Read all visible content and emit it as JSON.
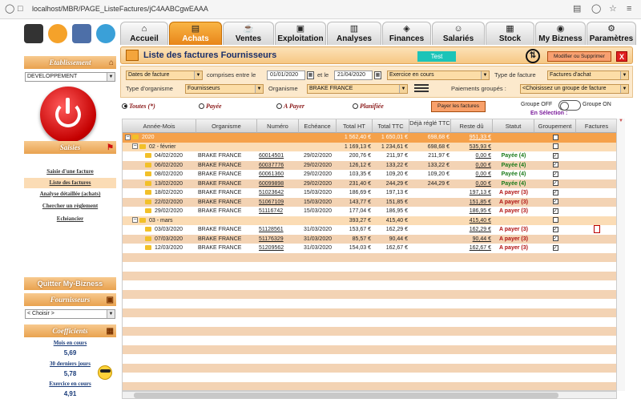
{
  "browser": {
    "url": "localhost/MBR/PAGE_ListeFactures/jC4AABCgwEAAA"
  },
  "colors": {
    "accent": "#F29A2E",
    "header_bar": "#F6C783",
    "paid": "#1A7A1A",
    "due": "#B01010",
    "test_badge": "#1BC4B8"
  },
  "sidebar": {
    "etablissement_title": "Etablissement",
    "etablissement_value": "DEVELOPPEMENT",
    "saisies_title": "Saisies",
    "menu": [
      "Saisie d'une facture",
      "Liste des factures",
      "Analyse détaillée (achats)",
      "Chercher un règlement",
      "Echéancier"
    ],
    "quit_label": "Quitter My-Bizness",
    "fournisseurs_title": "Fournisseurs",
    "fournisseurs_value": "< Choisir >",
    "coefficients_title": "Coefficients",
    "coefs": [
      {
        "label": "Mois en cours",
        "value": "5,69"
      },
      {
        "label": "30 derniers jours",
        "value": "5,78"
      },
      {
        "label": "Exercice en cours",
        "value": "4,91"
      }
    ]
  },
  "tabs": [
    {
      "label": "Accueil",
      "icon": "house-icon"
    },
    {
      "label": "Achats",
      "icon": "basket-icon"
    },
    {
      "label": "Ventes",
      "icon": "cup-icon"
    },
    {
      "label": "Exploitation",
      "icon": "machine-icon"
    },
    {
      "label": "Analyses",
      "icon": "chart-icon"
    },
    {
      "label": "Finances",
      "icon": "money-icon"
    },
    {
      "label": "Salariés",
      "icon": "people-icon"
    },
    {
      "label": "Stock",
      "icon": "box-icon"
    },
    {
      "label": "My Bizness",
      "icon": "brand-icon"
    },
    {
      "label": "Paramètres",
      "icon": "gears-icon"
    }
  ],
  "page": {
    "title": "Liste des factures Fournisseurs",
    "test_badge": "Test",
    "modify_button": "Modifier ou Supprimer",
    "close_button": "X"
  },
  "filters": {
    "date_type": "Dates de facture",
    "between_label": "comprises entre le",
    "date_from": "01/01/2020",
    "and_label": "et le",
    "date_to": "21/04/2020",
    "period": "Exercice en cours",
    "type_facture_label": "Type de facture",
    "type_facture": "Factures d'achat",
    "type_org_label": "Type d'organisme",
    "type_org": "Fournisseurs",
    "organisme_label": "Organisme",
    "organisme": "BRAKE FRANCE",
    "paiements_label": "Paiements groupés :",
    "paiements": "<Choisissez un groupe de facture"
  },
  "status_filter": {
    "options": [
      "Toutes (*)",
      "Payée",
      "A Payer",
      "Planifiée"
    ],
    "selected": 0,
    "pay_button": "Payer les factures",
    "group_off": "Groupe OFF",
    "group_on": "Groupe ON",
    "en_selection": "En Sélection :"
  },
  "table": {
    "columns": [
      "Année-Mois",
      "Organisme",
      "Numéro",
      "Echéance",
      "Total HT",
      "Total TTC",
      "Déjà réglé TTC",
      "Reste dû",
      "Statut",
      "Groupement",
      "Factures"
    ],
    "rows": [
      {
        "level": 0,
        "label": "2020",
        "ht": "1 562,40 €",
        "ttc": "1 650,01 €",
        "regle": "698,68 €",
        "reste": "951,33 €",
        "group": "unchecked",
        "style": "year"
      },
      {
        "level": 1,
        "label": "02 - février",
        "ht": "1 169,13 €",
        "ttc": "1 234,61 €",
        "regle": "698,68 €",
        "reste": "535,93 €",
        "group": "unchecked",
        "style": "month"
      },
      {
        "level": 2,
        "label": "04/02/2020",
        "org": "BRAKE FRANCE",
        "num": "60014501",
        "ech": "29/02/2020",
        "ht": "200,76 €",
        "ttc": "211,97 €",
        "regle": "211,97 €",
        "reste": "0,00 €",
        "statut": "Payée (4)",
        "group": "checked",
        "style": "light"
      },
      {
        "level": 2,
        "label": "06/02/2020",
        "org": "BRAKE FRANCE",
        "num": "60037776",
        "ech": "29/02/2020",
        "ht": "126,12 €",
        "ttc": "133,22 €",
        "regle": "133,22 €",
        "reste": "0,00 €",
        "statut": "Payée (4)",
        "group": "checked",
        "style": "dark"
      },
      {
        "level": 2,
        "label": "08/02/2020",
        "org": "BRAKE FRANCE",
        "num": "60061360",
        "ech": "29/02/2020",
        "ht": "103,35 €",
        "ttc": "109,20 €",
        "regle": "109,20 €",
        "reste": "0,00 €",
        "statut": "Payée (4)",
        "group": "checked",
        "style": "light"
      },
      {
        "level": 2,
        "label": "13/02/2020",
        "org": "BRAKE FRANCE",
        "num": "60099898",
        "ech": "29/02/2020",
        "ht": "231,40 €",
        "ttc": "244,29 €",
        "regle": "244,29 €",
        "reste": "0,00 €",
        "statut": "Payée (4)",
        "group": "checked",
        "style": "dark"
      },
      {
        "level": 2,
        "label": "18/02/2020",
        "org": "BRAKE FRANCE",
        "num": "51023642",
        "ech": "15/03/2020",
        "ht": "186,69 €",
        "ttc": "197,13 €",
        "regle": "",
        "reste": "197,13 €",
        "statut": "A payer (3)",
        "group": "checked",
        "style": "light"
      },
      {
        "level": 2,
        "label": "22/02/2020",
        "org": "BRAKE FRANCE",
        "num": "51067109",
        "ech": "15/03/2020",
        "ht": "143,77 €",
        "ttc": "151,85 €",
        "regle": "",
        "reste": "151,85 €",
        "statut": "A payer (3)",
        "group": "checked",
        "style": "dark"
      },
      {
        "level": 2,
        "label": "29/02/2020",
        "org": "BRAKE FRANCE",
        "num": "51116742",
        "ech": "15/03/2020",
        "ht": "177,04 €",
        "ttc": "186,95 €",
        "regle": "",
        "reste": "186,95 €",
        "statut": "A payer (3)",
        "group": "checked",
        "style": "light"
      },
      {
        "level": 1,
        "label": "03 - mars",
        "ht": "393,27 €",
        "ttc": "415,40 €",
        "regle": "",
        "reste": "415,40 €",
        "group": "unchecked",
        "style": "month"
      },
      {
        "level": 2,
        "label": "03/03/2020",
        "org": "BRAKE FRANCE",
        "num": "51128561",
        "ech": "31/03/2020",
        "ht": "153,67 €",
        "ttc": "162,29 €",
        "regle": "",
        "reste": "162,29 €",
        "statut": "A payer (3)",
        "group": "checked",
        "style": "light",
        "pdf": true
      },
      {
        "level": 2,
        "label": "07/03/2020",
        "org": "BRAKE FRANCE",
        "num": "51176329",
        "ech": "31/03/2020",
        "ht": "85,57 €",
        "ttc": "90,44 €",
        "regle": "",
        "reste": "90,44 €",
        "statut": "A payer (3)",
        "group": "checked",
        "style": "dark"
      },
      {
        "level": 2,
        "label": "12/03/2020",
        "org": "BRAKE FRANCE",
        "num": "51209562",
        "ech": "31/03/2020",
        "ht": "154,03 €",
        "ttc": "162,67 €",
        "regle": "",
        "reste": "162,67 €",
        "statut": "A payer (3)",
        "group": "checked",
        "style": "light"
      }
    ]
  }
}
